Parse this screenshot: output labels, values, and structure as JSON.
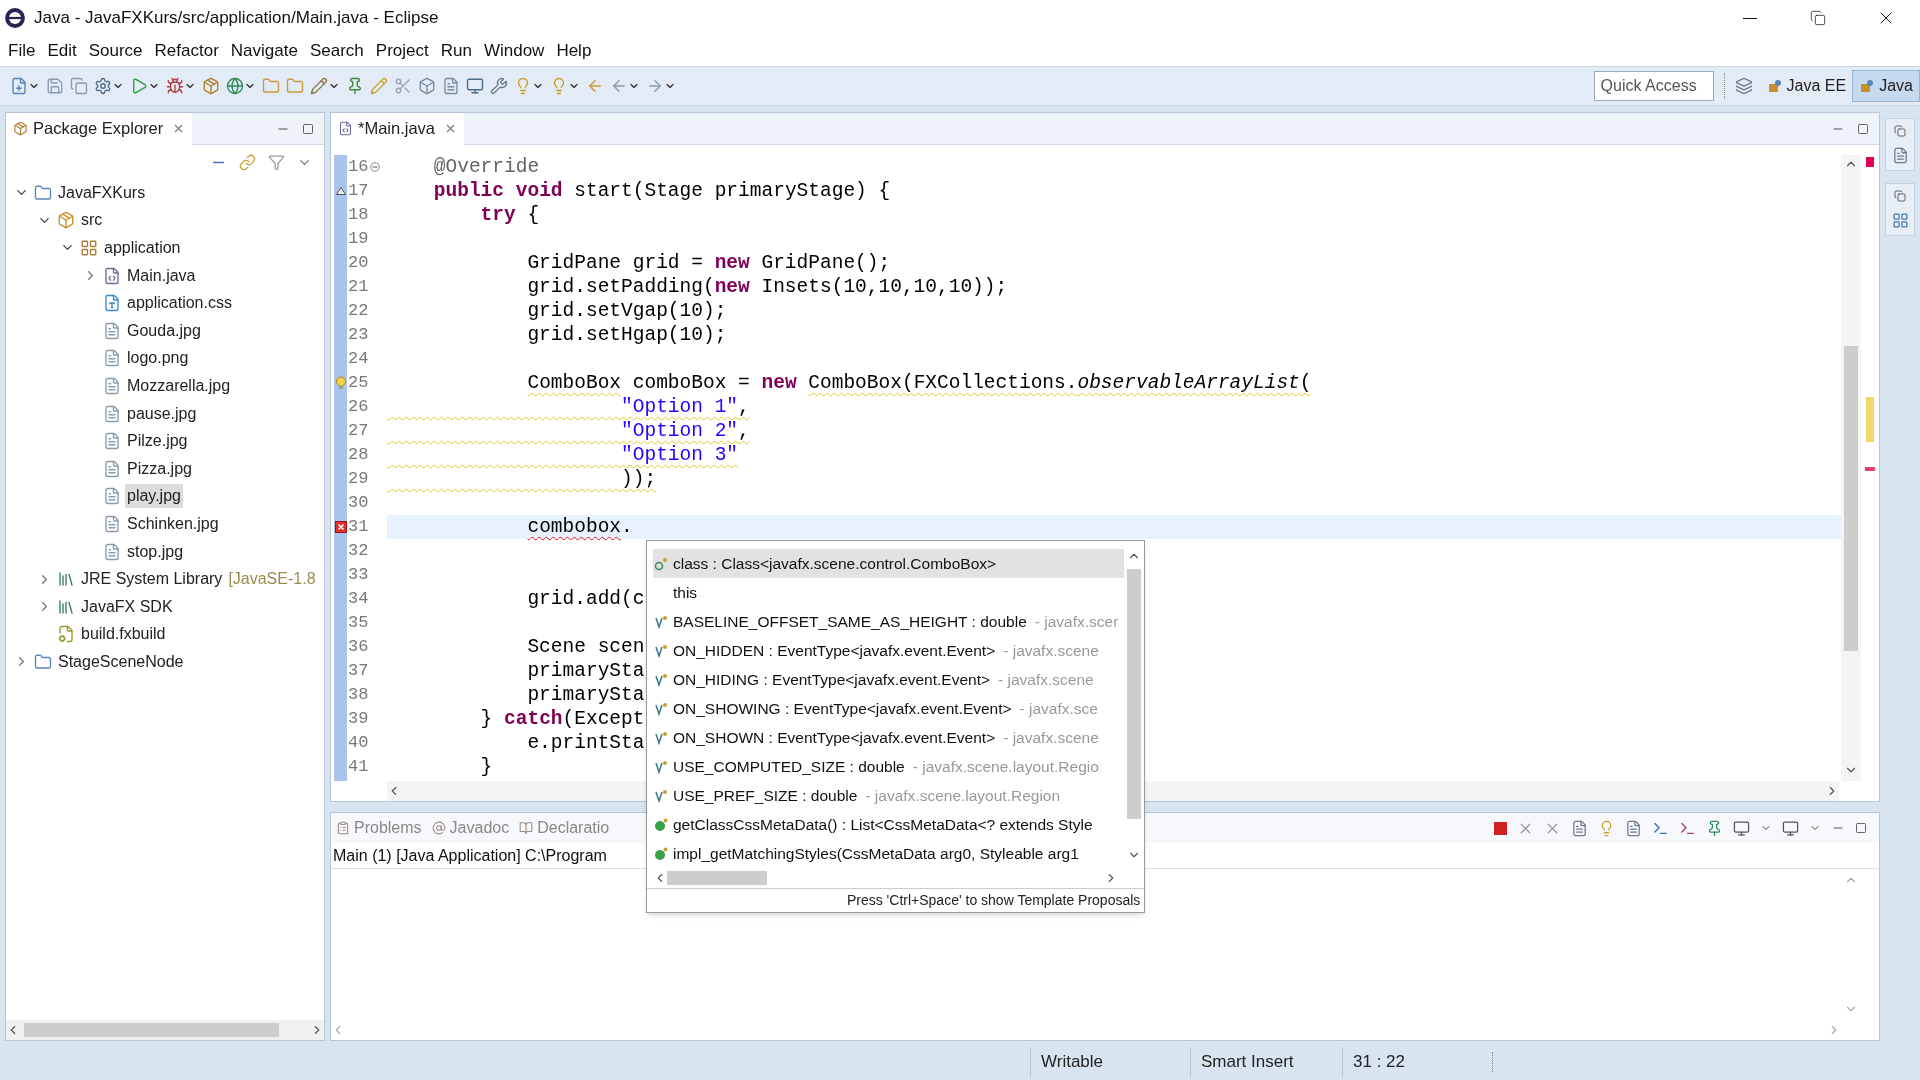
{
  "window": {
    "title": "Java - JavaFXKurs/src/application/Main.java - Eclipse"
  },
  "menu": [
    "File",
    "Edit",
    "Source",
    "Refactor",
    "Navigate",
    "Search",
    "Project",
    "Run",
    "Window",
    "Help"
  ],
  "quick_access": {
    "placeholder": "Quick Access"
  },
  "perspectives": [
    {
      "label": "Java EE",
      "selected": false
    },
    {
      "label": "Java",
      "selected": true
    }
  ],
  "package_explorer": {
    "title": "Package Explorer",
    "tree": [
      {
        "label": "JavaFXKurs",
        "kind": "project",
        "expanded": true,
        "selected": false,
        "children": [
          {
            "label": "src",
            "kind": "source",
            "expanded": true,
            "selected": false,
            "children": [
              {
                "label": "application",
                "kind": "package",
                "expanded": true,
                "selected": false,
                "children": [
                  {
                    "label": "Main.java",
                    "kind": "java",
                    "expanded": false,
                    "selected": false
                  },
                  {
                    "label": "application.css",
                    "kind": "css",
                    "selected": false
                  },
                  {
                    "label": "Gouda.jpg",
                    "kind": "file",
                    "selected": false
                  },
                  {
                    "label": "logo.png",
                    "kind": "file",
                    "selected": false
                  },
                  {
                    "label": "Mozzarella.jpg",
                    "kind": "file",
                    "selected": false
                  },
                  {
                    "label": "pause.jpg",
                    "kind": "file",
                    "selected": false
                  },
                  {
                    "label": "Pilze.jpg",
                    "kind": "file",
                    "selected": false
                  },
                  {
                    "label": "Pizza.jpg",
                    "kind": "file",
                    "selected": false
                  },
                  {
                    "label": "play.jpg",
                    "kind": "file",
                    "selected": true
                  },
                  {
                    "label": "Schinken.jpg",
                    "kind": "file",
                    "selected": false
                  },
                  {
                    "label": "stop.jpg",
                    "kind": "file",
                    "selected": false
                  }
                ]
              }
            ]
          },
          {
            "label": "JRE System Library",
            "suffix": "[JavaSE-1.8",
            "kind": "library",
            "expanded": false,
            "selected": false
          },
          {
            "label": "JavaFX SDK",
            "kind": "library",
            "expanded": false,
            "selected": false
          },
          {
            "label": "build.fxbuild",
            "kind": "build",
            "selected": false
          }
        ]
      },
      {
        "label": "StageSceneNode",
        "kind": "project",
        "expanded": false,
        "selected": false
      }
    ]
  },
  "editor": {
    "tab": {
      "label": "*Main.java",
      "selected": true
    },
    "lines": [
      {
        "number": "16",
        "foldable": true,
        "current": false,
        "segments": [
          {
            "text": "    @Override",
            "kind": "annotation"
          }
        ]
      },
      {
        "number": "17",
        "overrides": true,
        "current": false,
        "segments": [
          {
            "text": "    public",
            "kind": "keyword"
          },
          {
            "text": " void",
            "kind": "keyword"
          },
          {
            "text": " start(Stage primaryStage) {",
            "kind": "plain"
          }
        ]
      },
      {
        "number": "18",
        "current": false,
        "segments": [
          {
            "text": "        try",
            "kind": "keyword"
          },
          {
            "text": " {",
            "kind": "plain"
          }
        ]
      },
      {
        "number": "19",
        "current": false
      },
      {
        "number": "20",
        "current": false,
        "segments": [
          {
            "text": "            GridPane grid = ",
            "kind": "plain"
          },
          {
            "text": "new",
            "kind": "keyword"
          },
          {
            "text": " GridPane();",
            "kind": "plain"
          }
        ]
      },
      {
        "number": "21",
        "current": false,
        "segments": [
          {
            "text": "            grid.setPadding(",
            "kind": "plain"
          },
          {
            "text": "new",
            "kind": "keyword"
          },
          {
            "text": " Insets(10,10,10,10));",
            "kind": "plain"
          }
        ]
      },
      {
        "number": "22",
        "current": false,
        "segments": [
          {
            "text": "            grid.setVgap(10);",
            "kind": "plain"
          }
        ]
      },
      {
        "number": "23",
        "current": false,
        "segments": [
          {
            "text": "            grid.setHgap(10);",
            "kind": "plain"
          }
        ]
      },
      {
        "number": "24",
        "current": false
      },
      {
        "number": "25",
        "has_warning": true,
        "current": false,
        "segments": [
          {
            "text": "            ComboBox",
            "kind": "plain",
            "warning": true
          },
          {
            "text": " comboBox = ",
            "kind": "plain"
          },
          {
            "text": "new",
            "kind": "keyword"
          },
          {
            "text": " ComboBox(FXCollections.",
            "kind": "plain",
            "warning": true
          },
          {
            "text": "observableArrayList",
            "kind": "italic",
            "warning": true
          },
          {
            "text": "(",
            "kind": "plain",
            "warning": true
          }
        ]
      },
      {
        "number": "26",
        "current": false,
        "warning": true,
        "segments": [
          {
            "text": "                    \"Option 1\"",
            "kind": "string"
          },
          {
            "text": ",",
            "kind": "plain"
          }
        ]
      },
      {
        "number": "27",
        "current": false,
        "warning": true,
        "segments": [
          {
            "text": "                    \"Option 2\"",
            "kind": "string"
          },
          {
            "text": ",",
            "kind": "plain"
          }
        ]
      },
      {
        "number": "28",
        "current": false,
        "warning": true,
        "segments": [
          {
            "text": "                    \"Option 3\"",
            "kind": "string"
          }
        ]
      },
      {
        "number": "29",
        "current": false,
        "warning": true,
        "segments": [
          {
            "text": "                    ));",
            "kind": "plain"
          }
        ]
      },
      {
        "number": "30",
        "current": false
      },
      {
        "number": "31",
        "has_error": true,
        "current": true,
        "segments": [
          {
            "text": "            combobox",
            "kind": "plain",
            "error": true
          },
          {
            "text": ".",
            "kind": "plain"
          }
        ]
      },
      {
        "number": "32",
        "current": false
      },
      {
        "number": "33",
        "current": false
      },
      {
        "number": "34",
        "current": false,
        "segments": [
          {
            "text": "            grid.add(c",
            "kind": "plain"
          }
        ]
      },
      {
        "number": "35",
        "current": false
      },
      {
        "number": "36",
        "current": false,
        "segments": [
          {
            "text": "            Scene scen",
            "kind": "plain"
          }
        ]
      },
      {
        "number": "37",
        "current": false,
        "segments": [
          {
            "text": "            primarySta",
            "kind": "plain"
          }
        ]
      },
      {
        "number": "38",
        "current": false,
        "segments": [
          {
            "text": "            primarySta",
            "kind": "plain"
          }
        ]
      },
      {
        "number": "39",
        "current": false,
        "segments": [
          {
            "text": "        } ",
            "kind": "plain"
          },
          {
            "text": "catch",
            "kind": "keyword"
          },
          {
            "text": "(Except",
            "kind": "plain"
          }
        ]
      },
      {
        "number": "40",
        "current": false,
        "segments": [
          {
            "text": "            e.printSta",
            "kind": "plain"
          }
        ]
      },
      {
        "number": "41",
        "current": false,
        "segments": [
          {
            "text": "        }",
            "kind": "plain"
          }
        ]
      }
    ]
  },
  "completion_popup": {
    "proposals": [
      {
        "kind": "class",
        "text": "class : Class<javafx.scene.control.ComboBox>",
        "selected": true
      },
      {
        "kind": "plain",
        "text": "this",
        "selected": false
      },
      {
        "kind": "field",
        "text": "BASELINE_OFFSET_SAME_AS_HEIGHT : double",
        "detail": "- javafx.scer",
        "selected": false
      },
      {
        "kind": "field",
        "text": "ON_HIDDEN : EventType<javafx.event.Event>",
        "detail": "- javafx.scene",
        "selected": false
      },
      {
        "kind": "field",
        "text": "ON_HIDING : EventType<javafx.event.Event>",
        "detail": "- javafx.scene",
        "selected": false
      },
      {
        "kind": "field",
        "text": "ON_SHOWING : EventType<javafx.event.Event>",
        "detail": "- javafx.sce",
        "selected": false
      },
      {
        "kind": "field",
        "text": "ON_SHOWN : EventType<javafx.event.Event>",
        "detail": "- javafx.scene",
        "selected": false
      },
      {
        "kind": "field",
        "text": "USE_COMPUTED_SIZE : double",
        "detail": "- javafx.scene.layout.Regio",
        "selected": false
      },
      {
        "kind": "field",
        "text": "USE_PREF_SIZE : double",
        "detail": "- javafx.scene.layout.Region",
        "selected": false
      },
      {
        "kind": "method",
        "text": "getClassCssMetaData() : List<CssMetaData<? extends Style",
        "selected": false
      },
      {
        "kind": "method",
        "text": "impl_getMatchingStyles(CssMetaData arg0, Styleable arg1",
        "selected": false
      }
    ],
    "footer": "Press 'Ctrl+Space' to show Template Proposals"
  },
  "bottom_panel": {
    "tabs": [
      {
        "label": "Problems",
        "kind": "problems",
        "selected": false
      },
      {
        "label": "Javadoc",
        "kind": "javadoc",
        "selected": false
      },
      {
        "label": "Declaratio",
        "kind": "declaration",
        "selected": false
      }
    ],
    "console_title": "Main (1) [Java Application] C:\\Program"
  },
  "status_bar": [
    "Writable",
    "Smart Insert",
    "31 : 22"
  ]
}
